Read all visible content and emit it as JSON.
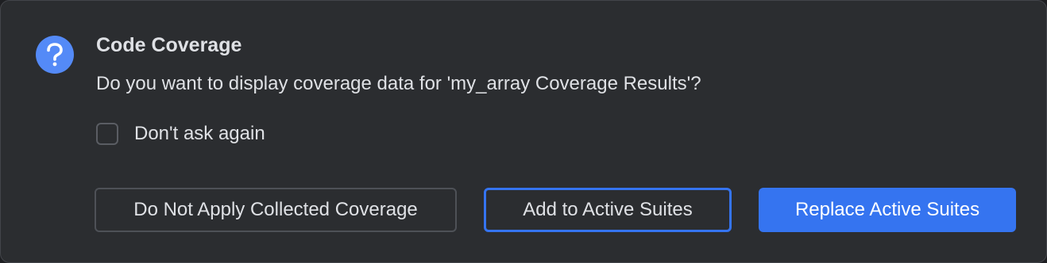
{
  "dialog": {
    "icon": "question-icon",
    "title": "Code Coverage",
    "message": "Do you want to display coverage data for 'my_array Coverage Results'?",
    "dont_ask_again": {
      "label": "Don't ask again",
      "checked": false
    },
    "buttons": {
      "do_not_apply": "Do Not Apply Collected Coverage",
      "add_to_active": "Add to Active Suites",
      "replace_active": "Replace Active Suites"
    }
  },
  "colors": {
    "background": "#2b2d30",
    "accent": "#3574f0",
    "icon": "#548af7",
    "text": "#dfe1e5"
  }
}
